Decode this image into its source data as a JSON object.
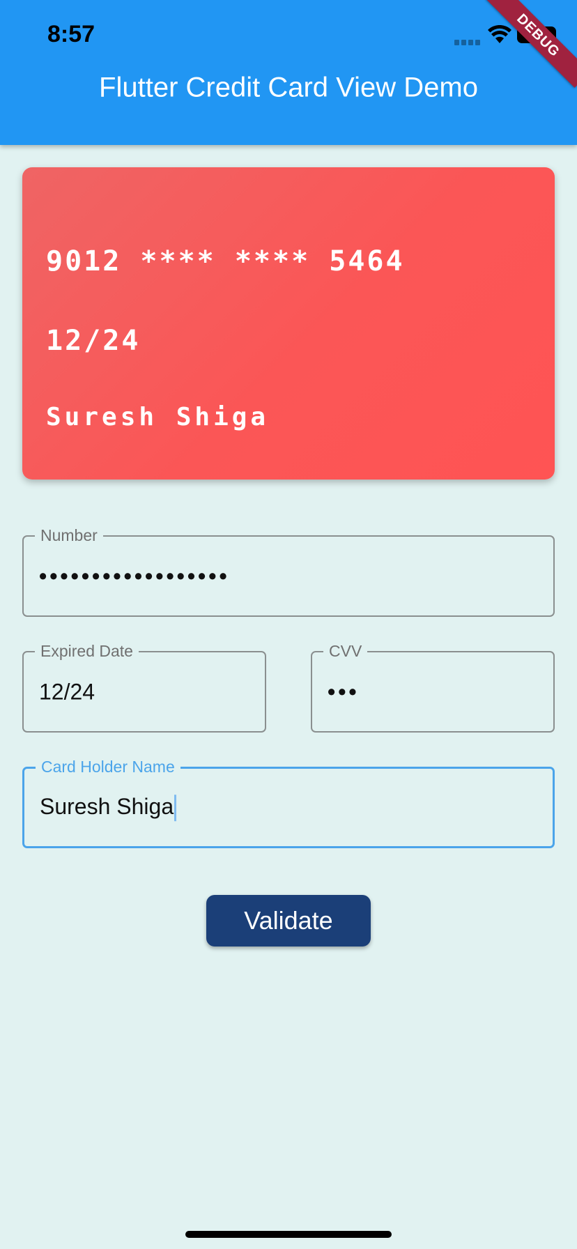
{
  "status_bar": {
    "time": "8:57",
    "wifi_icon": "wifi-icon",
    "battery_icon": "battery-icon",
    "signal_icon": "cellular-signal-icon"
  },
  "debug_banner": "DEBUG",
  "appbar": {
    "title": "Flutter Credit Card View Demo",
    "color": "#2196f3"
  },
  "card": {
    "number": "9012 **** **** 5464",
    "expiry": "12/24",
    "holder": "Suresh Shiga",
    "color": "#ff5454"
  },
  "form": {
    "number": {
      "label": "Number",
      "value": "••••••••••••••••••"
    },
    "expiry": {
      "label": "Expired Date",
      "value": "12/24"
    },
    "cvv": {
      "label": "CVV",
      "value": "•••"
    },
    "holder": {
      "label": "Card Holder Name",
      "value": "Suresh Shiga",
      "focused": true,
      "focus_color": "#4ba4ea"
    }
  },
  "validate_button": {
    "label": "Validate",
    "color": "#1b3f78"
  },
  "background_color": "#e1f2f1"
}
